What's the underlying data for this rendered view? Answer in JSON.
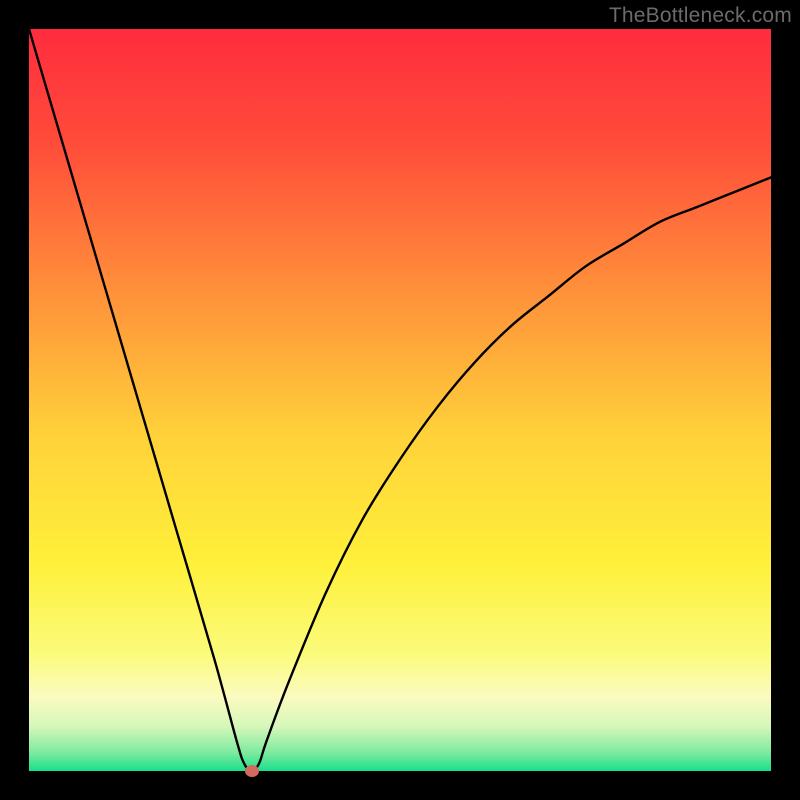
{
  "watermark": "TheBottleneck.com",
  "chart_data": {
    "type": "line",
    "title": "",
    "xlabel": "",
    "ylabel": "",
    "xlim": [
      0,
      100
    ],
    "ylim": [
      0,
      100
    ],
    "background": "red-yellow-green-gradient",
    "series": [
      {
        "name": "bottleneck-curve",
        "x": [
          0,
          5,
          10,
          15,
          20,
          25,
          28,
          29,
          30,
          31,
          32,
          35,
          40,
          45,
          50,
          55,
          60,
          65,
          70,
          75,
          80,
          85,
          90,
          95,
          100
        ],
        "y": [
          100,
          83,
          66,
          49,
          32,
          15,
          4,
          1,
          0,
          1,
          4,
          12,
          24,
          34,
          42,
          49,
          55,
          60,
          64,
          68,
          71,
          74,
          76,
          78,
          80
        ]
      }
    ],
    "marker": {
      "x": 30,
      "y": 0,
      "color": "#d36a5f"
    }
  },
  "colors": {
    "frame": "#000000",
    "curve": "#000000",
    "watermark": "#6b6b6b",
    "gradient_stops": [
      {
        "pos": 0.0,
        "color": "#ff2c3e"
      },
      {
        "pos": 0.15,
        "color": "#ff4b3a"
      },
      {
        "pos": 0.35,
        "color": "#ff8f3a"
      },
      {
        "pos": 0.55,
        "color": "#ffd23a"
      },
      {
        "pos": 0.72,
        "color": "#fff03a"
      },
      {
        "pos": 0.84,
        "color": "#fbfb7a"
      },
      {
        "pos": 0.9,
        "color": "#fbfbc0"
      },
      {
        "pos": 0.94,
        "color": "#d6f7ba"
      },
      {
        "pos": 0.975,
        "color": "#7eeaa0"
      },
      {
        "pos": 1.0,
        "color": "#19e08a"
      }
    ]
  }
}
